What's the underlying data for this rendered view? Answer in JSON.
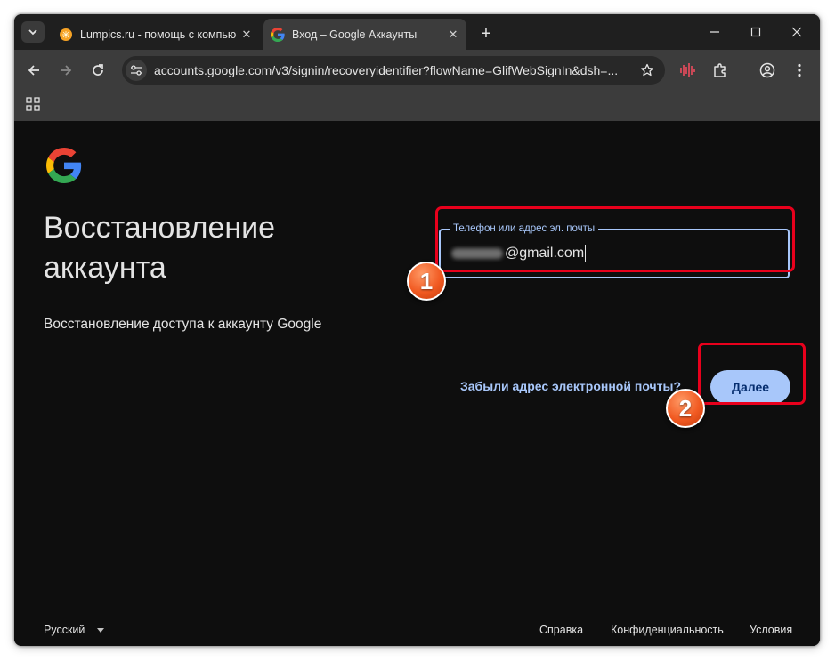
{
  "browser": {
    "tabs": [
      {
        "title": "Lumpics.ru - помощь с компью",
        "active": false,
        "favicon": "orange-circle-icon"
      },
      {
        "title": "Вход – Google Аккаунты",
        "active": true,
        "favicon": "google-g-icon"
      }
    ],
    "url": "accounts.google.com/v3/signin/recoveryidentifier?flowName=GlifWebSignIn&dsh=..."
  },
  "page": {
    "heading": "Восстановление аккаунта",
    "subtitle": "Восстановление доступа к аккаунту Google",
    "field": {
      "label": "Телефон или адрес эл. почты",
      "value_visible": "@gmail.com"
    },
    "forgot_email": "Забыли адрес электронной почты?",
    "next_button": "Далее"
  },
  "annotations": {
    "badge_1": "1",
    "badge_2": "2",
    "color": "#e8001c"
  },
  "footer": {
    "language": "Русский",
    "help": "Справка",
    "privacy": "Конфиденциальность",
    "terms": "Условия"
  },
  "colors": {
    "accent": "#a8c7fa",
    "button_text": "#062e6f",
    "page_bg": "#0e0e0e"
  }
}
